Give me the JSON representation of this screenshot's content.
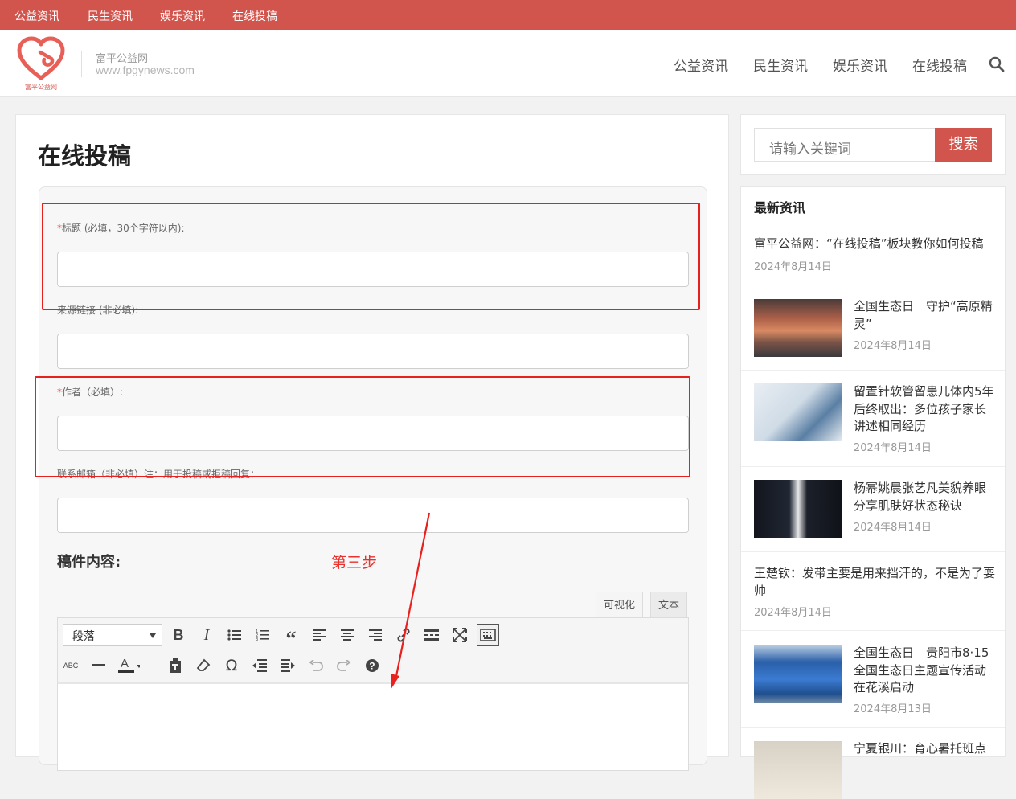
{
  "topbar": {
    "links": [
      "公益资讯",
      "民生资讯",
      "娱乐资讯",
      "在线投稿"
    ]
  },
  "header": {
    "logo_text": "富平公益网",
    "site_name": "富平公益网",
    "site_url": "www.fpgynews.com",
    "nav": [
      "公益资讯",
      "民生资讯",
      "娱乐资讯",
      "在线投稿"
    ],
    "search_icon": "search-icon"
  },
  "main": {
    "title": "在线投稿",
    "form": {
      "title_required": "*",
      "title_label": "标题 (必填，30个字符以内):",
      "title_value": "",
      "source_label": "来源链接 (非必填):",
      "source_value": "",
      "author_required": "*",
      "author_label": "作者（必填）:",
      "author_value": "",
      "email_label": "联系邮箱（非必填）注：用于投稿或拒稿回复：",
      "email_value": "",
      "content_label": "稿件内容:",
      "step_annotation": "第三步",
      "tab_visual": "可视化",
      "tab_text": "文本",
      "format_select": "段落",
      "toolbar_icons": [
        "bold-icon",
        "italic-icon",
        "bullet-list-icon",
        "numbered-list-icon",
        "blockquote-icon",
        "align-left-icon",
        "align-center-icon",
        "align-right-icon",
        "link-icon",
        "read-more-icon",
        "fullscreen-icon",
        "toolbar-toggle-icon",
        "strikethrough-icon",
        "horizontal-line-icon",
        "text-color-icon",
        "paste-text-icon",
        "clear-format-icon",
        "special-character-icon",
        "outdent-icon",
        "indent-icon",
        "undo-icon",
        "redo-icon",
        "help-icon"
      ]
    }
  },
  "sidebar": {
    "search_placeholder": "请输入关键词",
    "search_button": "搜索",
    "latest_title": "最新资讯",
    "news": [
      {
        "title": "富平公益网：“在线投稿”板块教你如何投稿",
        "date": "2024年8月14日"
      },
      {
        "title": "全国生态日｜守护“高原精灵”",
        "date": "2024年8月14日"
      },
      {
        "title": "留置针软管留患儿体内5年后终取出：多位孩子家长讲述相同经历",
        "date": "2024年8月14日"
      },
      {
        "title": "杨幂姚晨张艺凡美貌养眼分享肌肤好状态秘诀",
        "date": "2024年8月14日"
      },
      {
        "title": "王楚钦：发带主要是用来挡汗的，不是为了耍帅",
        "date": "2024年8月14日"
      },
      {
        "title": "全国生态日｜贵阳市8·15全国生态日主题宣传活动在花溪启动",
        "date": "2024年8月13日"
      },
      {
        "title": "宁夏银川：育心暑托班点",
        "date": ""
      }
    ]
  },
  "colors": {
    "brand": "#d2554d",
    "annotation": "#e8211e"
  }
}
